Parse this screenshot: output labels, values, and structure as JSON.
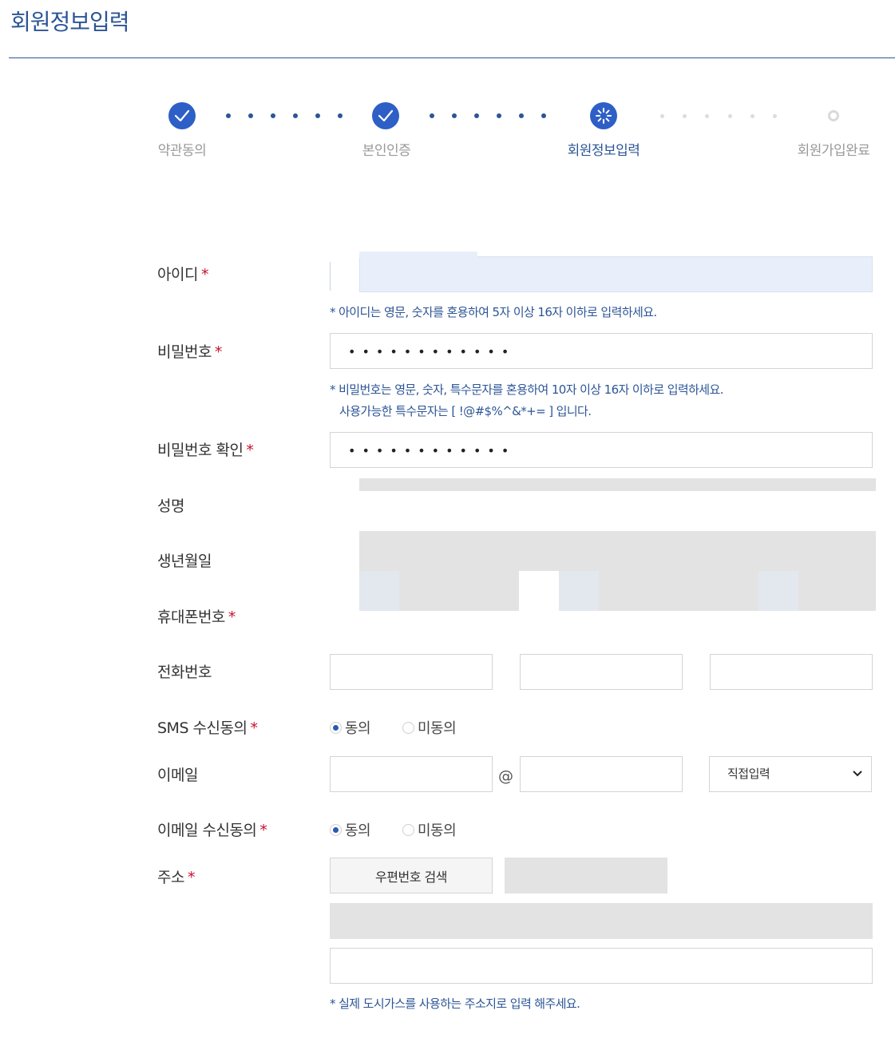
{
  "page": {
    "title": "회원정보입력"
  },
  "steps": [
    {
      "label": "약관동의",
      "state": "done"
    },
    {
      "label": "본인인증",
      "state": "done"
    },
    {
      "label": "회원정보입력",
      "state": "current"
    },
    {
      "label": "회원가입완료",
      "state": "pending"
    }
  ],
  "colors": {
    "brand": "#2c5596",
    "step_active": "#2e5fc7",
    "required": "#c8102e",
    "id_input_bg": "#e8effa"
  },
  "form": {
    "required_mark": "*",
    "id": {
      "label": "아이디",
      "help": "* 아이디는 영문, 숫자를 혼용하여 5자 이상 16자 이하로 입력하세요."
    },
    "password": {
      "label": "비밀번호",
      "value_mask": "••••••••••••",
      "help_line1": "* 비밀번호는 영문, 숫자, 특수문자를 혼용하여 10자 이상 16자 이하로 입력하세요.",
      "help_line2": "사용가능한 특수문자는 [ !@#$%^&*+= ] 입니다."
    },
    "password_confirm": {
      "label": "비밀번호 확인",
      "value_mask": "••••••••••••"
    },
    "name": {
      "label": "성명"
    },
    "birth": {
      "label": "생년월일"
    },
    "mobile": {
      "label": "휴대폰번호"
    },
    "phone": {
      "label": "전화번호"
    },
    "sms_consent": {
      "label": "SMS 수신동의",
      "agree": "동의",
      "disagree": "미동의",
      "selected": "동의"
    },
    "email": {
      "label": "이메일",
      "at": "@",
      "domain_select": "직접입력"
    },
    "email_consent": {
      "label": "이메일 수신동의",
      "agree": "동의",
      "disagree": "미동의",
      "selected": "동의"
    },
    "address": {
      "label": "주소",
      "search_button": "우편번호 검색",
      "help": "* 실제 도시가스를 사용하는 주소지로 입력 해주세요."
    }
  }
}
